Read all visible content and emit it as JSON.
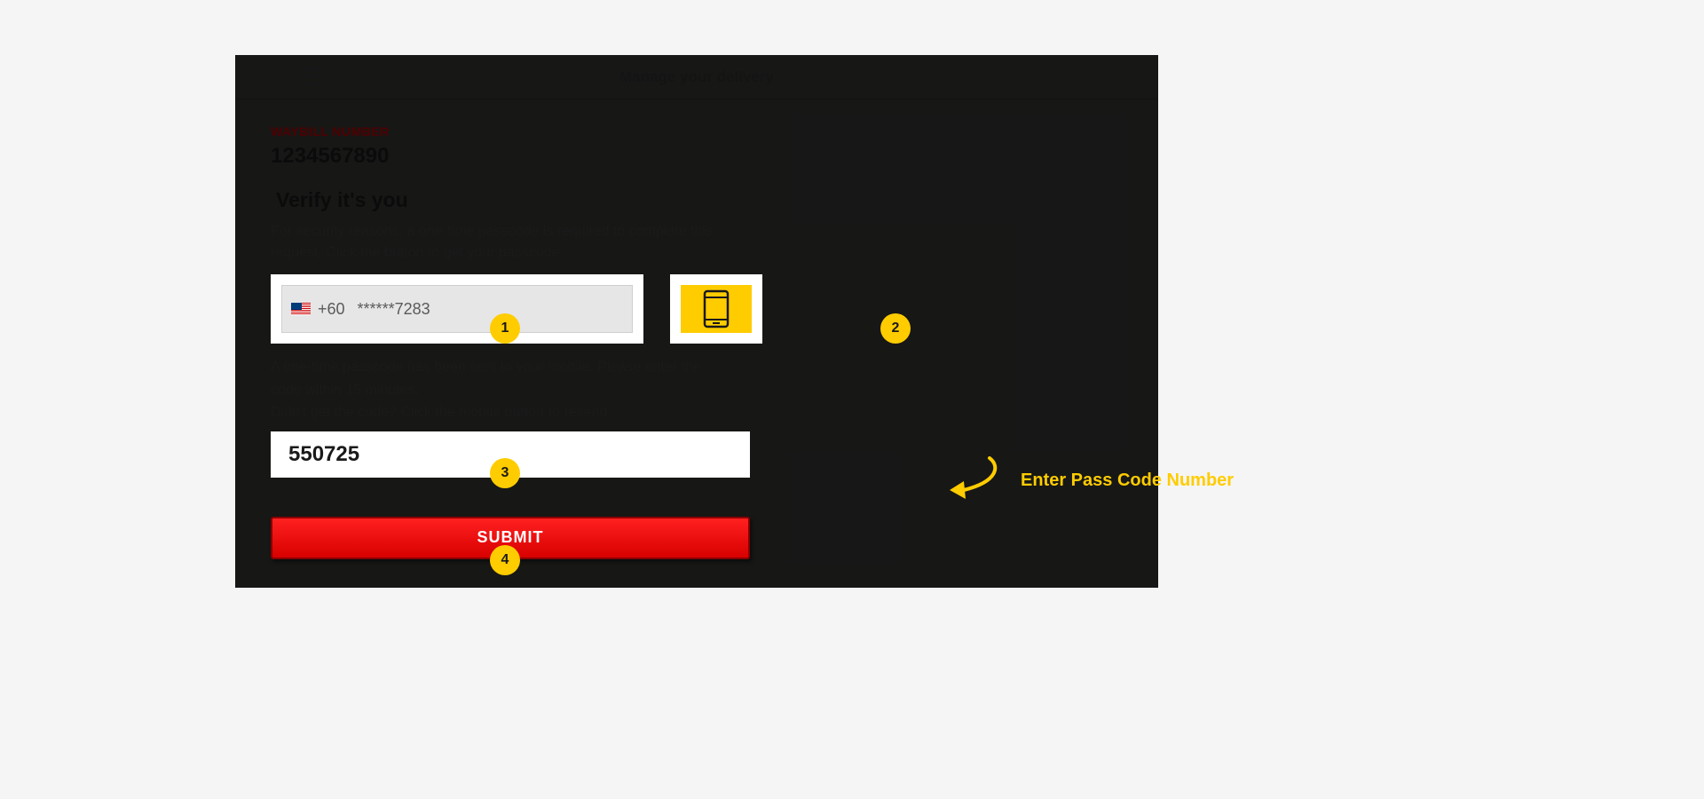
{
  "colors": {
    "accent_yellow": "#ffcc00",
    "accent_red": "#d80000",
    "label_red": "#b00000"
  },
  "topbar": {
    "title": "Manage your delivery"
  },
  "waybill": {
    "label": "WAYBILL NUMBER",
    "number": "1234567890"
  },
  "verify": {
    "title": "Verify it's you",
    "description": "For security reasons, a one-time passcode is required to complete this request. Click the button to get your passcode."
  },
  "phone": {
    "country_code": "+60",
    "masked": "******7283",
    "flag": "malaysia"
  },
  "info": {
    "sent": "A one-time passcode has been sent to your mobile. Please enter the code within 15 minutes.",
    "resend": "Didn't get the code? Click the mobile button to resend."
  },
  "passcode": {
    "value": "550725"
  },
  "submit": {
    "label": "SUBMIT"
  },
  "steps": {
    "1": "1",
    "2": "2",
    "3": "3",
    "4": "4"
  },
  "annotation": {
    "passcode_hint": "Enter Pass Code Number"
  }
}
